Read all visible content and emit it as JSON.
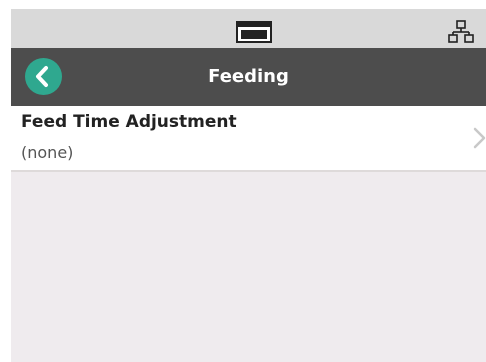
{
  "status_bar": {
    "icons": [
      "battery-icon",
      "network-icon"
    ]
  },
  "header": {
    "title": "Feeding",
    "back_icon": "chevron-left-icon",
    "accent_color": "#2fa88f",
    "bar_color": "#4d4d4d"
  },
  "settings": [
    {
      "label": "Feed Time Adjustment",
      "value": "(none)",
      "icon": "chevron-right-icon"
    }
  ]
}
